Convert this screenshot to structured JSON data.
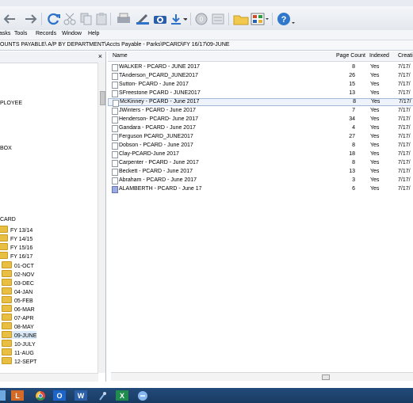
{
  "menu": [
    "asks",
    "Tools",
    "Records",
    "Window",
    "Help"
  ],
  "path": "OUNTS PAYABLE\\ A/P BY DEPARTMENT\\Accts Payable - Parks\\PCARD\\FY 16/17\\09-JUNE",
  "tree": {
    "partial_items": [
      "PLOYEE",
      "BOX",
      "CARD"
    ],
    "fiscal_years": [
      "FY 13/14",
      "FY 14/15",
      "FY 15/16",
      "FY 16/17"
    ],
    "months": [
      "01-OCT",
      "02-NOV",
      "03-DEC",
      "04-JAN",
      "05-FEB",
      "06-MAR",
      "07-APR",
      "08-MAY",
      "09-JUNE",
      "10-JULY",
      "11-AUG",
      "12-SEPT"
    ]
  },
  "columns": {
    "name": "Name",
    "page_count": "Page Count",
    "indexed": "Indexed",
    "created": "Creati"
  },
  "documents": [
    {
      "name": "WALKER - PCARD - JUNE 2017",
      "pages": "8",
      "indexed": "Yes",
      "created": "7/17/"
    },
    {
      "name": "TAnderson_PCARD_JUNE2017",
      "pages": "26",
      "indexed": "Yes",
      "created": "7/17/"
    },
    {
      "name": "Sutton- PCARD - June 2017",
      "pages": "15",
      "indexed": "Yes",
      "created": "7/17/"
    },
    {
      "name": "SFreestone PCARD - JUNE2017",
      "pages": "13",
      "indexed": "Yes",
      "created": "7/17/"
    },
    {
      "name": "McKinney - PCARD - June 2017",
      "pages": "8",
      "indexed": "Yes",
      "created": "7/17/"
    },
    {
      "name": "JWinters - PCARD - June 2017",
      "pages": "7",
      "indexed": "Yes",
      "created": "7/17/"
    },
    {
      "name": "Henderson- PCARD- June 2017",
      "pages": "34",
      "indexed": "Yes",
      "created": "7/17/"
    },
    {
      "name": "Gandara - PCARD - June 2017",
      "pages": "4",
      "indexed": "Yes",
      "created": "7/17/"
    },
    {
      "name": "Ferguson PCARD_JUNE2017",
      "pages": "27",
      "indexed": "Yes",
      "created": "7/17/"
    },
    {
      "name": "Dobson - PCARD - June 2017",
      "pages": "8",
      "indexed": "Yes",
      "created": "7/17/"
    },
    {
      "name": "Clay-PCARD-June 2017",
      "pages": "18",
      "indexed": "Yes",
      "created": "7/17/"
    },
    {
      "name": "Carpenter - PCARD - June 2017",
      "pages": "8",
      "indexed": "Yes",
      "created": "7/17/"
    },
    {
      "name": "Beckett - PCARD - June 2017",
      "pages": "13",
      "indexed": "Yes",
      "created": "7/17/"
    },
    {
      "name": "Abraham - PCARD - June 2017",
      "pages": "3",
      "indexed": "Yes",
      "created": "7/17/"
    },
    {
      "name": "ALAMBERTH - PCARD - June 17",
      "pages": "6",
      "indexed": "Yes",
      "created": "7/17/"
    }
  ]
}
